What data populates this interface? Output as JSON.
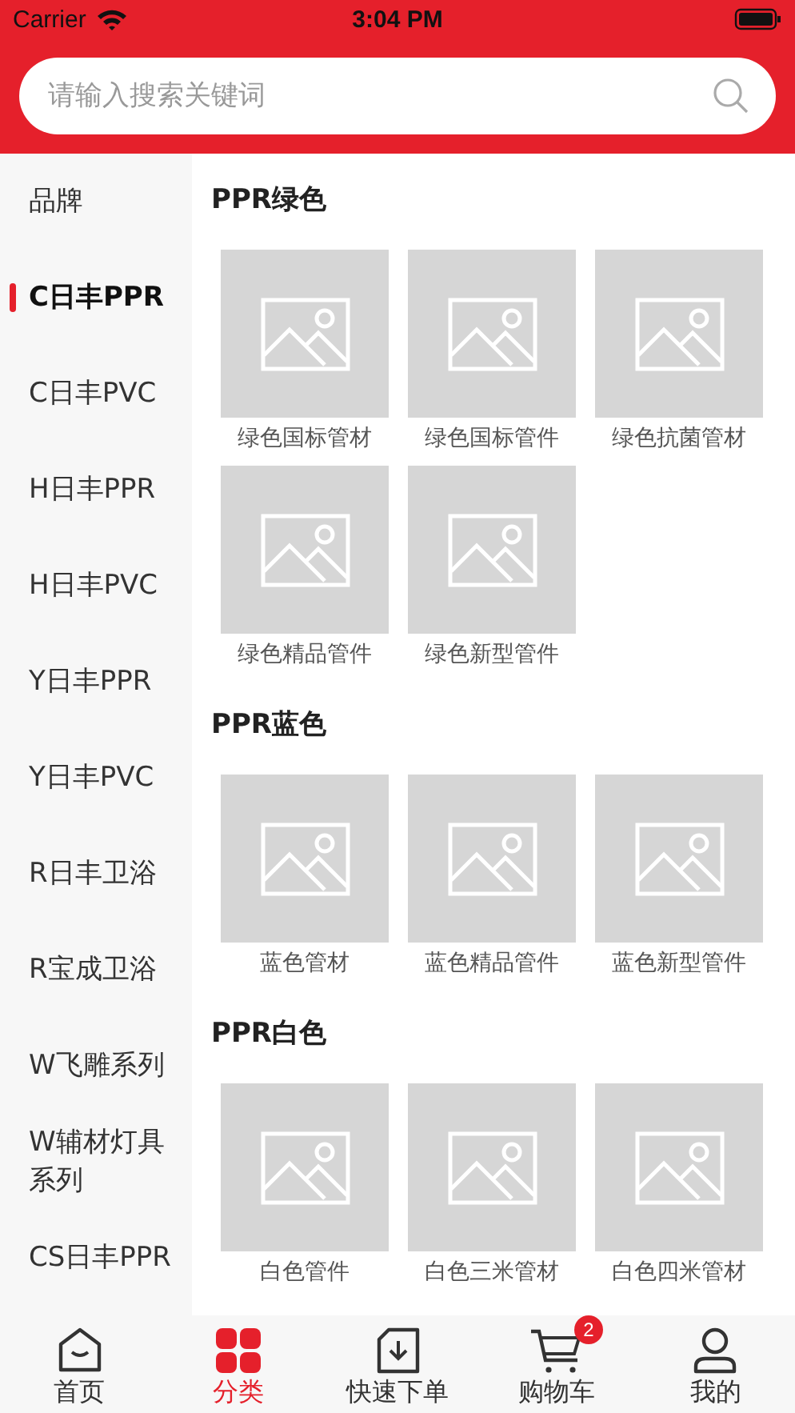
{
  "status_bar": {
    "carrier": "Carrier",
    "time": "3:04 PM"
  },
  "search": {
    "placeholder": "请输入搜索关键词"
  },
  "sidebar": {
    "items": [
      {
        "label": "品牌",
        "selected": false
      },
      {
        "label": "C日丰PPR",
        "selected": true
      },
      {
        "label": "C日丰PVC",
        "selected": false
      },
      {
        "label": "H日丰PPR",
        "selected": false
      },
      {
        "label": "H日丰PVC",
        "selected": false
      },
      {
        "label": "Y日丰PPR",
        "selected": false
      },
      {
        "label": "Y日丰PVC",
        "selected": false
      },
      {
        "label": "R日丰卫浴",
        "selected": false
      },
      {
        "label": "R宝成卫浴",
        "selected": false
      },
      {
        "label": "W飞雕系列",
        "selected": false
      },
      {
        "label": "W辅材灯具系列",
        "selected": false
      },
      {
        "label": "CS日丰PPR",
        "selected": false
      }
    ]
  },
  "sections": [
    {
      "title": "PPR绿色",
      "items": [
        "绿色国标管材",
        "绿色国标管件",
        "绿色抗菌管材",
        "绿色精品管件",
        "绿色新型管件"
      ]
    },
    {
      "title": "PPR蓝色",
      "items": [
        "蓝色管材",
        "蓝色精品管件",
        "蓝色新型管件"
      ]
    },
    {
      "title": "PPR白色",
      "items": [
        "白色管件",
        "白色三米管材",
        "白色四米管材"
      ]
    }
  ],
  "tab_bar": [
    {
      "kind": "home",
      "label": "首页",
      "selected": false
    },
    {
      "kind": "category",
      "label": "分类",
      "selected": true
    },
    {
      "kind": "order",
      "label": "快速下单",
      "selected": false
    },
    {
      "kind": "cart",
      "label": "购物车",
      "selected": false,
      "badge": "2"
    },
    {
      "kind": "profile",
      "label": "我的",
      "selected": false
    }
  ]
}
